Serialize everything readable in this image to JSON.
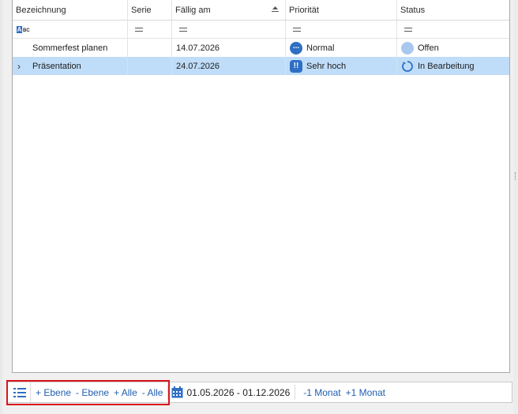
{
  "columns": [
    "Bezeichnung",
    "Serie",
    "Fällig am",
    "Priorität",
    "Status"
  ],
  "filter_icon": "abc-filter-icon",
  "rows": [
    {
      "bezeichnung": "Sommerfest planen",
      "serie": "",
      "faellig": "14.07.2026",
      "prioritaet": "Normal",
      "prio_icon": "priority-normal-icon",
      "status": "Offen",
      "status_icon": "status-open-icon",
      "expandable": false,
      "selected": false
    },
    {
      "bezeichnung": "Präsentation",
      "serie": "",
      "faellig": "24.07.2026",
      "prioritaet": "Sehr hoch",
      "prio_icon": "priority-very-high-icon",
      "status": "In Bearbeitung",
      "status_icon": "status-in-progress-icon",
      "expandable": true,
      "selected": true
    }
  ],
  "toolbar": {
    "plus_level": "+ Ebene",
    "minus_level": "- Ebene",
    "plus_all": "+ Alle",
    "minus_all": "- Alle",
    "date_range": "01.05.2026 - 01.12.2026",
    "minus_month": "-1 Monat",
    "plus_month": "+1 Monat"
  },
  "colors": {
    "selection": "#bfdcf8",
    "accent": "#2f6fc3",
    "link": "#1f5faf",
    "highlight_frame": "#d9141c"
  }
}
